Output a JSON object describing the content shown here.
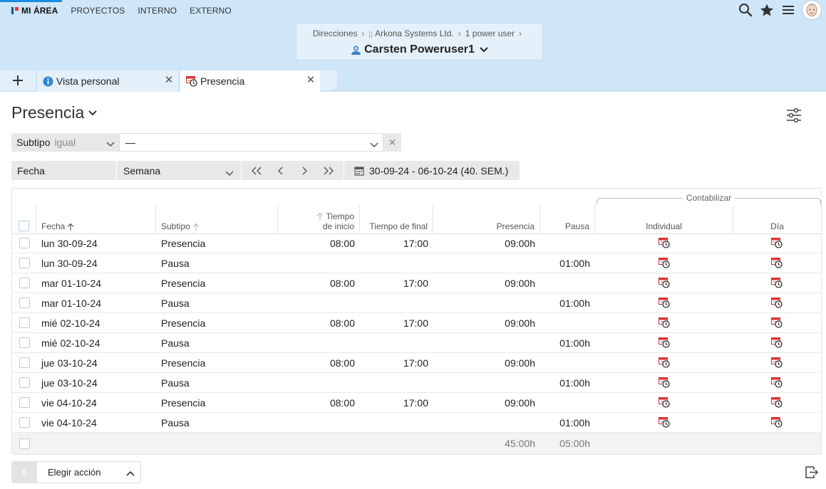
{
  "topnav": {
    "items": [
      {
        "label": "MI ÁREA"
      },
      {
        "label": "PROYECTOS"
      },
      {
        "label": "INTERNO"
      },
      {
        "label": "EXTERNO"
      }
    ],
    "accent_color": "#1a8de0"
  },
  "header_icons": [
    "search-icon",
    "star-icon",
    "menu-icon",
    "avatar"
  ],
  "context": {
    "breadcrumbs": [
      "Direcciones",
      "Arkona Systems Ltd.",
      "1 power user"
    ],
    "user": "Carsten Poweruser1"
  },
  "tabs": [
    {
      "label": "Vista personal",
      "icon": "info-icon"
    },
    {
      "label": "Presencia",
      "icon": "attendance-icon",
      "active": true
    }
  ],
  "page": {
    "title": "Presencia"
  },
  "filter": {
    "field": "Subtipo",
    "operator": "igual",
    "value": "—"
  },
  "date_filter": {
    "field": "Fecha",
    "period": "Semana",
    "range": "30-09-24 - 06-10-24 (40. SEM.)"
  },
  "table": {
    "group_label": "Contabilizar",
    "headers": {
      "fecha": "Fecha",
      "subtipo": "Subtipo",
      "tiempo_inicio_1": "Tiempo",
      "tiempo_inicio_2": "de inicio",
      "tiempo_final": "Tiempo de final",
      "presencia": "Presencia",
      "pausa": "Pausa",
      "individual": "Individual",
      "dia": "Día"
    },
    "rows": [
      {
        "fecha": "lun 30-09-24",
        "subtipo": "Presencia",
        "inicio": "08:00",
        "final": "17:00",
        "presencia": "09:00h",
        "pausa": ""
      },
      {
        "fecha": "lun 30-09-24",
        "subtipo": "Pausa",
        "inicio": "",
        "final": "",
        "presencia": "",
        "pausa": "01:00h"
      },
      {
        "fecha": "mar 01-10-24",
        "subtipo": "Presencia",
        "inicio": "08:00",
        "final": "17:00",
        "presencia": "09:00h",
        "pausa": ""
      },
      {
        "fecha": "mar 01-10-24",
        "subtipo": "Pausa",
        "inicio": "",
        "final": "",
        "presencia": "",
        "pausa": "01:00h"
      },
      {
        "fecha": "mié 02-10-24",
        "subtipo": "Presencia",
        "inicio": "08:00",
        "final": "17:00",
        "presencia": "09:00h",
        "pausa": ""
      },
      {
        "fecha": "mié 02-10-24",
        "subtipo": "Pausa",
        "inicio": "",
        "final": "",
        "presencia": "",
        "pausa": "01:00h"
      },
      {
        "fecha": "jue 03-10-24",
        "subtipo": "Presencia",
        "inicio": "08:00",
        "final": "17:00",
        "presencia": "09:00h",
        "pausa": ""
      },
      {
        "fecha": "jue 03-10-24",
        "subtipo": "Pausa",
        "inicio": "",
        "final": "",
        "presencia": "",
        "pausa": "01:00h"
      },
      {
        "fecha": "vie 04-10-24",
        "subtipo": "Presencia",
        "inicio": "08:00",
        "final": "17:00",
        "presencia": "09:00h",
        "pausa": ""
      },
      {
        "fecha": "vie 04-10-24",
        "subtipo": "Pausa",
        "inicio": "",
        "final": "",
        "presencia": "",
        "pausa": "01:00h"
      }
    ],
    "totals": {
      "presencia": "45:00h",
      "pausa": "05:00h"
    }
  },
  "actions": {
    "count": "0",
    "label": "Elegir acción"
  }
}
